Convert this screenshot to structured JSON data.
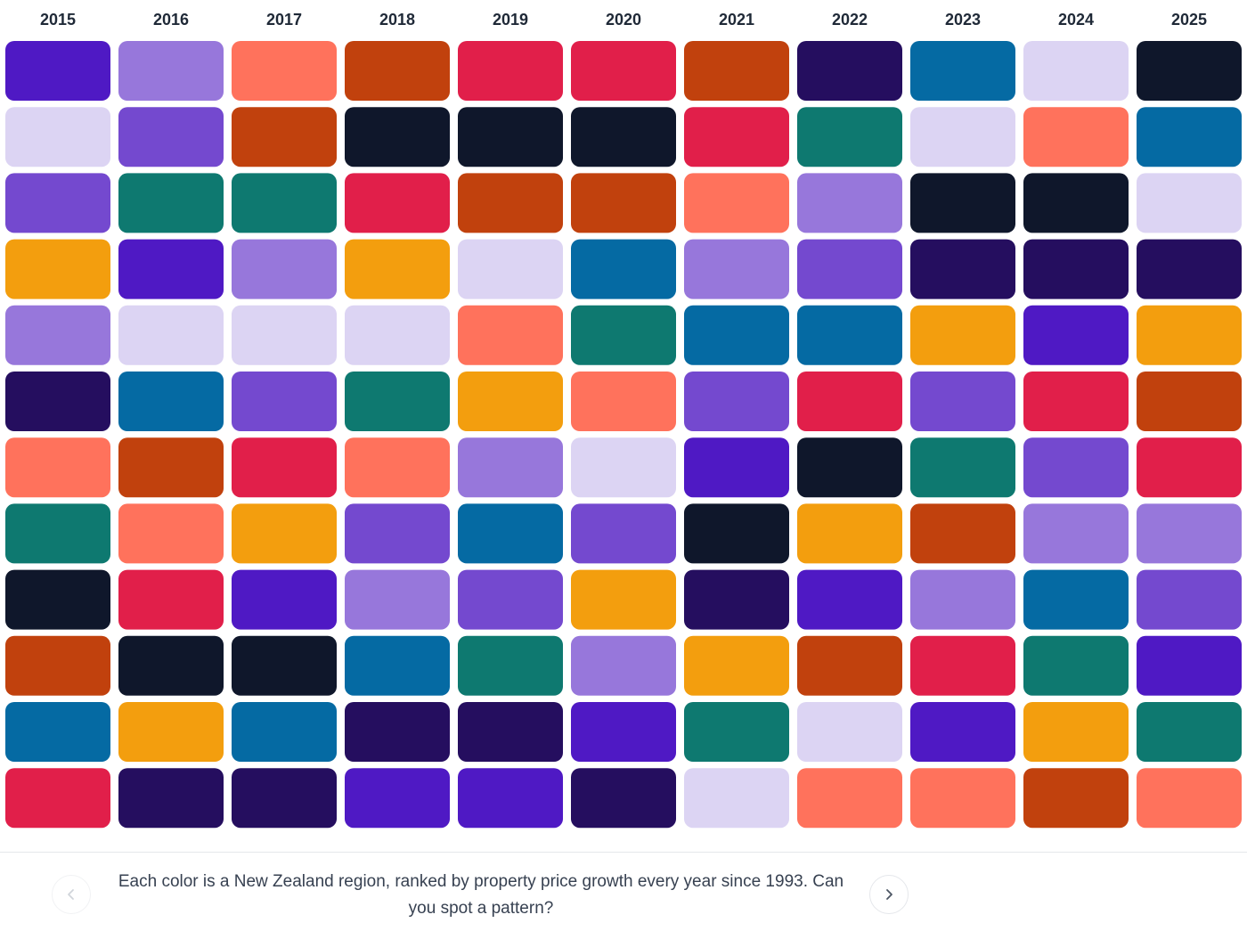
{
  "chart_data": {
    "type": "heatmap",
    "title": "",
    "xlabel": "",
    "ylabel": "",
    "x": [
      "2015",
      "2016",
      "2017",
      "2018",
      "2019",
      "2020",
      "2021",
      "2022",
      "2023",
      "2024",
      "2025"
    ],
    "ranks": 12,
    "palette": {
      "violet": "#4f19c4",
      "lavender": "#9777db",
      "coral": "#ff725c",
      "rust": "#c1410d",
      "crimson": "#e11f4a",
      "plum": "#250e5f",
      "ocean": "#056aa3",
      "mist": "#dcd4f3",
      "navy": "#0f172b",
      "teal": "#0e7970",
      "purple": "#7449cf",
      "amber": "#f39e0e"
    },
    "columns": [
      [
        "violet",
        "mist",
        "purple",
        "amber",
        "lavender",
        "plum",
        "coral",
        "teal",
        "navy",
        "rust",
        "ocean",
        "crimson"
      ],
      [
        "lavender",
        "purple",
        "teal",
        "violet",
        "mist",
        "ocean",
        "rust",
        "coral",
        "crimson",
        "navy",
        "amber",
        "plum"
      ],
      [
        "coral",
        "rust",
        "teal",
        "lavender",
        "mist",
        "purple",
        "crimson",
        "amber",
        "violet",
        "navy",
        "ocean",
        "plum"
      ],
      [
        "rust",
        "navy",
        "crimson",
        "amber",
        "mist",
        "teal",
        "coral",
        "purple",
        "lavender",
        "ocean",
        "plum",
        "violet"
      ],
      [
        "crimson",
        "navy",
        "rust",
        "mist",
        "coral",
        "amber",
        "lavender",
        "ocean",
        "purple",
        "teal",
        "plum",
        "violet"
      ],
      [
        "crimson",
        "navy",
        "rust",
        "ocean",
        "teal",
        "coral",
        "mist",
        "purple",
        "amber",
        "lavender",
        "violet",
        "plum"
      ],
      [
        "rust",
        "crimson",
        "coral",
        "lavender",
        "ocean",
        "purple",
        "violet",
        "navy",
        "plum",
        "amber",
        "teal",
        "mist"
      ],
      [
        "plum",
        "teal",
        "lavender",
        "purple",
        "ocean",
        "crimson",
        "navy",
        "amber",
        "violet",
        "rust",
        "mist",
        "coral"
      ],
      [
        "ocean",
        "mist",
        "navy",
        "plum",
        "amber",
        "purple",
        "teal",
        "rust",
        "lavender",
        "crimson",
        "violet",
        "coral"
      ],
      [
        "mist",
        "coral",
        "navy",
        "plum",
        "violet",
        "crimson",
        "purple",
        "lavender",
        "ocean",
        "teal",
        "amber",
        "rust"
      ],
      [
        "navy",
        "ocean",
        "mist",
        "plum",
        "amber",
        "rust",
        "crimson",
        "lavender",
        "purple",
        "violet",
        "teal",
        "coral"
      ]
    ]
  },
  "caption": "Each color is a New Zealand region, ranked by property price growth every year since 1993. Can you spot a pattern?",
  "nav": {
    "prev_icon": "chevron-left-icon",
    "next_icon": "chevron-right-icon",
    "prev_color": "#d1d5db",
    "next_color": "#4b5563"
  }
}
